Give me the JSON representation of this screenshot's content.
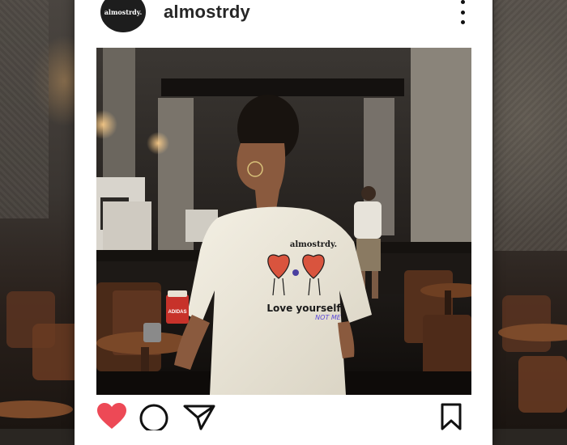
{
  "post": {
    "username": "almostrdy",
    "avatar_text": "almostrdy.",
    "image": {
      "shirt_brand_text": "almostrdy.",
      "shirt_slogan": "Love yourself",
      "shirt_slogan_overlay": "NOT ME",
      "cup_text": "ADIDAS"
    },
    "actions": {
      "like_icon": "heart-filled-icon",
      "comment_icon": "comment-icon",
      "share_icon": "paper-plane-icon",
      "save_icon": "bookmark-icon"
    },
    "colors": {
      "heart": "#ed4956",
      "username": "#262626",
      "avatar_bg": "#1d1d1d"
    }
  }
}
